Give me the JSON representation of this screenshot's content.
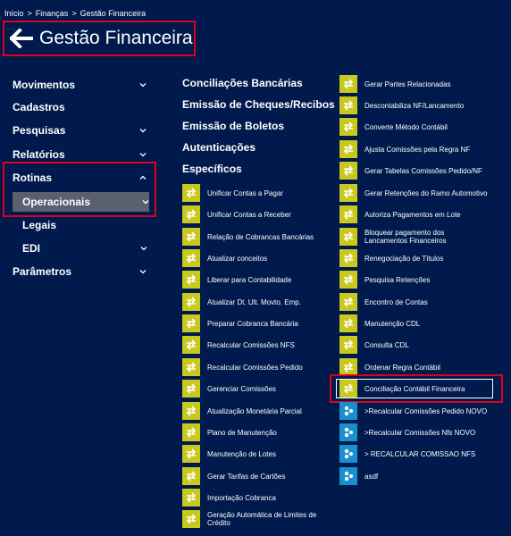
{
  "breadcrumb": [
    "Início",
    ">",
    "Finanças",
    ">",
    "Gestão Financeira"
  ],
  "header": {
    "title": "Gestão Financeira"
  },
  "sidebar": {
    "movimentos": "Movimentos",
    "cadastros": "Cadastros",
    "pesquisas": "Pesquisas",
    "relatorios": "Relatórios",
    "rotinas": "Rotinas",
    "operacionais": "Operacionais",
    "legais": "Legais",
    "edi": "EDI",
    "parametros": "Parâmetros"
  },
  "categories": {
    "conciliacoes": "Conciliações Bancárias",
    "cheques": "Emissão de Cheques/Recibos",
    "boletos": "Emissão de Boletos",
    "autenticacoes": "Autenticações",
    "especificos": "Específicos"
  },
  "col1": [
    "Unificar Contas a Pagar",
    "Unificar Contas a Receber",
    "Relação de Cobrancas Bancárias",
    "Atualizar conceitos",
    "Liberar para Contabilidade",
    "Atualizar Dt. Ult. Movto. Emp.",
    "Preparar Cobranca Bancária",
    "Recalcular Comissões NFS",
    "Recalcular Comissões Pedido",
    "Gerenciar Comissões",
    "Atualização Monetária Parcial",
    "Plano de Manutenção",
    "Manutenção de Lotes",
    "Gerar Tarifas de Cartões",
    "Importação Cobranca",
    "Geração Automática de Limites de",
    "Crédito"
  ],
  "col2": [
    "Gerar Partes Relacionadas",
    "Descontabiliza NF/Lancamento",
    "Converte Método Contábil",
    "Ajusta Comissões pela Regra NF",
    "Gerar Tabelas Comissões Pedido/NF",
    "Gerar Retenções do Ramo Automotivo",
    "Autoriza Pagamentos em Lote",
    "Bloquear pagamento dos",
    "Lancamentos Financeiros",
    "Renegociação de Títulos",
    "Pesquisa Retenções",
    "Encontro de Contas",
    "Manutenção CDL",
    "Consulta CDL",
    "Ordenar Regra Contábil",
    "Conciliação Contábil Financeira",
    ">Recalcular Comissões Pedido NOVO",
    ">Recalcular Comissões Nfs NOVO",
    "> RECALCULAR COMISSAO NFS",
    "asdf"
  ],
  "colors": {
    "background": "#001a4d",
    "icon_yellow": "#c8c81e",
    "icon_blue": "#1a8fd0",
    "highlight": "#e0001a"
  }
}
